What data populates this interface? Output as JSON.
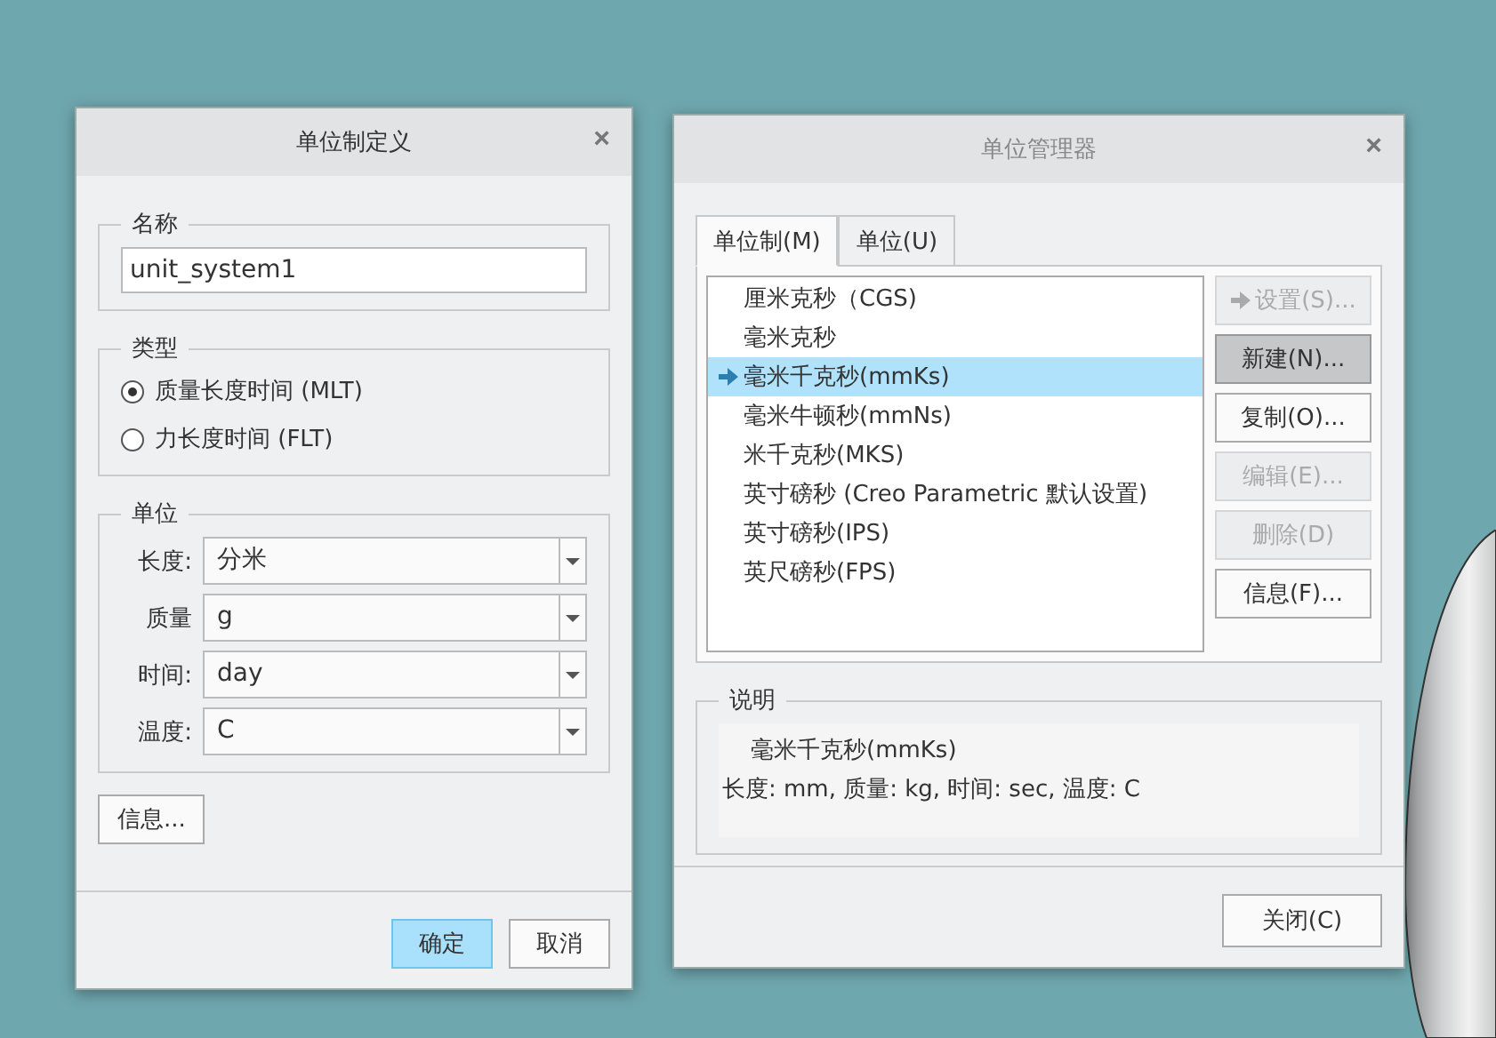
{
  "unit_system_dialog": {
    "title": "单位制定义",
    "close": "×",
    "name_group": {
      "label": "名称",
      "value": "unit_system1"
    },
    "type_group": {
      "label": "类型",
      "options": [
        {
          "label": "质量长度时间 (MLT)",
          "selected": true
        },
        {
          "label": "力长度时间 (FLT)",
          "selected": false
        }
      ]
    },
    "units_group": {
      "label": "单位",
      "fields": [
        {
          "label": "长度:",
          "value": "分米"
        },
        {
          "label": "质量",
          "value": "g"
        },
        {
          "label": "时间:",
          "value": "day"
        },
        {
          "label": "温度:",
          "value": "C"
        }
      ]
    },
    "info_button": "信息...",
    "buttons": [
      {
        "label": "确定",
        "primary": true
      },
      {
        "label": "取消",
        "primary": false
      }
    ]
  },
  "unit_manager_dialog": {
    "title": "单位管理器",
    "close": "×",
    "tabs": [
      {
        "label": "单位制(M)",
        "selected": true
      },
      {
        "label": "单位(U)",
        "selected": false
      }
    ],
    "systems": [
      {
        "label": "厘米克秒（CGS)",
        "selected": false
      },
      {
        "label": "毫米克秒",
        "selected": false
      },
      {
        "label": "毫米千克秒(mmKs)",
        "selected": true
      },
      {
        "label": "毫米牛顿秒(mmNs)",
        "selected": false
      },
      {
        "label": "米千克秒(MKS)",
        "selected": false
      },
      {
        "label": "英寸磅秒 (Creo Parametric 默认设置)",
        "selected": false
      },
      {
        "label": "英寸磅秒(IPS)",
        "selected": false
      },
      {
        "label": "英尺磅秒(FPS)",
        "selected": false
      }
    ],
    "actions": [
      {
        "kind": "set",
        "label": "设置(S)...",
        "disabled": true,
        "pressed": false
      },
      {
        "kind": "plain",
        "label": "新建(N)...",
        "disabled": false,
        "pressed": true
      },
      {
        "kind": "plain",
        "label": "复制(O)...",
        "disabled": false,
        "pressed": false
      },
      {
        "kind": "plain",
        "label": "编辑(E)...",
        "disabled": true,
        "pressed": false
      },
      {
        "kind": "plain",
        "label": "删除(D)",
        "disabled": true,
        "pressed": false
      },
      {
        "kind": "plain",
        "label": "信息(F)...",
        "disabled": false,
        "pressed": false
      }
    ],
    "description": {
      "label": "说明",
      "lines": [
        "毫米千克秒(mmKs)",
        "长度: mm, 质量: kg, 时间: sec, 温度: C"
      ]
    },
    "close_button": "关闭(C)"
  }
}
